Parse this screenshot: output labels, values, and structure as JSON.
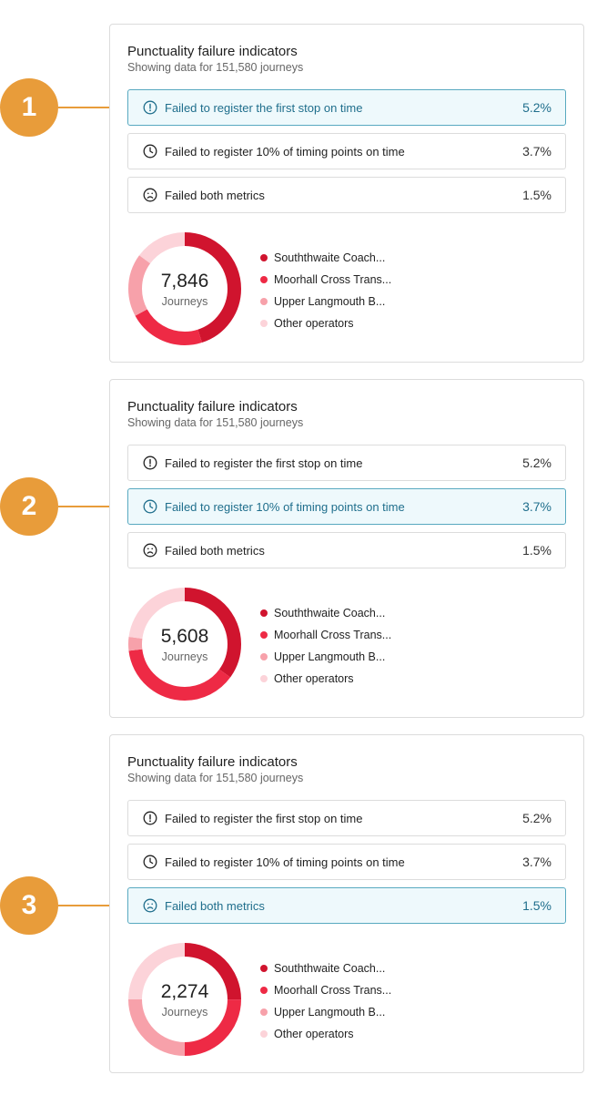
{
  "callouts": [
    "1",
    "2",
    "3"
  ],
  "colors": {
    "accent": "#e89c3a",
    "active_bg": "#eef9fc",
    "active_border": "#58a9c0",
    "active_text": "#1f6e8c",
    "operators": [
      "#d0142e",
      "#ee2a45",
      "#f7a1aa",
      "#fcd3d9"
    ]
  },
  "panels": [
    {
      "title": "Punctuality failure indicators",
      "subtitle": "Showing data for 151,580 journeys",
      "selected_metric": 0,
      "metrics": [
        {
          "icon": "exclamation-circle-icon",
          "label": "Failed to register the first stop on time",
          "value": "5.2%"
        },
        {
          "icon": "clock-icon",
          "label": "Failed to register 10% of timing points on time",
          "value": "3.7%"
        },
        {
          "icon": "sad-face-icon",
          "label": "Failed both metrics",
          "value": "1.5%"
        }
      ],
      "donut": {
        "total": "7,846",
        "unit": "Journeys",
        "shares": [
          0.45,
          0.22,
          0.18,
          0.15
        ]
      },
      "legend": [
        "Souththwaite Coach...",
        "Moorhall Cross Trans...",
        "Upper Langmouth B...",
        "Other operators"
      ]
    },
    {
      "title": "Punctuality failure indicators",
      "subtitle": "Showing data for 151,580 journeys",
      "selected_metric": 1,
      "metrics": [
        {
          "icon": "exclamation-circle-icon",
          "label": "Failed to register the first stop on time",
          "value": "5.2%"
        },
        {
          "icon": "clock-icon",
          "label": "Failed to register 10% of timing points on time",
          "value": "3.7%"
        },
        {
          "icon": "sad-face-icon",
          "label": "Failed both metrics",
          "value": "1.5%"
        }
      ],
      "donut": {
        "total": "5,608",
        "unit": "Journeys",
        "shares": [
          0.35,
          0.38,
          0.04,
          0.23
        ]
      },
      "legend": [
        "Souththwaite Coach...",
        "Moorhall Cross Trans...",
        "Upper Langmouth B...",
        "Other operators"
      ]
    },
    {
      "title": "Punctuality failure indicators",
      "subtitle": "Showing data for 151,580 journeys",
      "selected_metric": 2,
      "metrics": [
        {
          "icon": "exclamation-circle-icon",
          "label": "Failed to register the first stop on time",
          "value": "5.2%"
        },
        {
          "icon": "clock-icon",
          "label": "Failed to register 10% of timing points on time",
          "value": "3.7%"
        },
        {
          "icon": "sad-face-icon",
          "label": "Failed both metrics",
          "value": "1.5%"
        }
      ],
      "donut": {
        "total": "2,274",
        "unit": "Journeys",
        "shares": [
          0.25,
          0.25,
          0.25,
          0.25
        ]
      },
      "legend": [
        "Souththwaite Coach...",
        "Moorhall Cross Trans...",
        "Upper Langmouth B...",
        "Other operators"
      ]
    }
  ]
}
